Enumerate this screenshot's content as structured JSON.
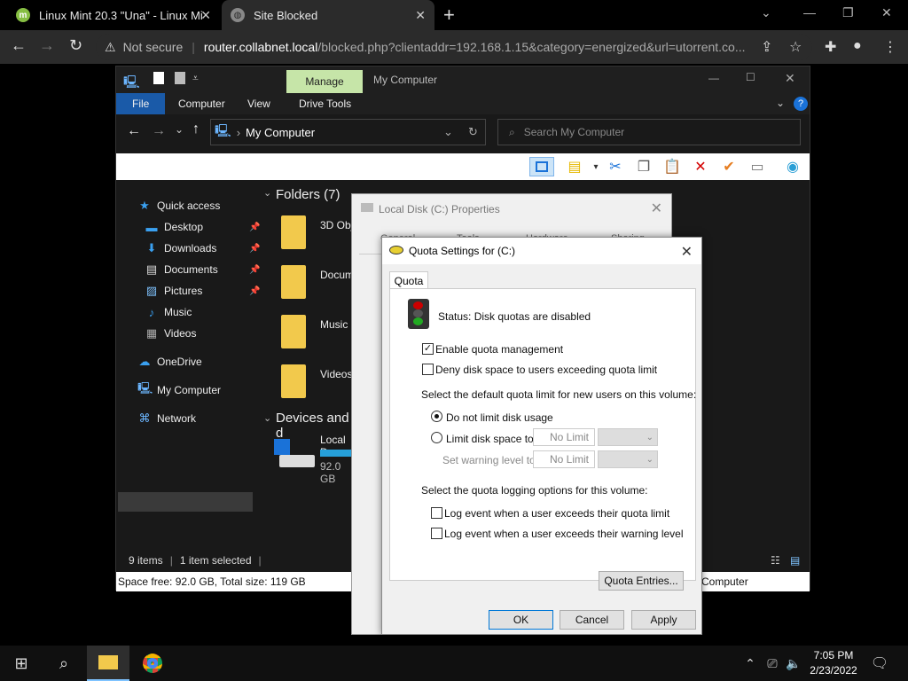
{
  "browser": {
    "tabs": [
      {
        "title": "Linux Mint 20.3 \"Una\" - Linux Mi",
        "favicon": "mint-logo-icon"
      },
      {
        "title": "Site Blocked",
        "favicon": "globe-icon"
      }
    ],
    "address": {
      "not_secure": "Not secure",
      "host": "router.collabnet.local",
      "path": "/blocked.php?clientaddr=192.168.1.15&category=energized&url=utorrent.co..."
    }
  },
  "explorer": {
    "ribbon_context": "Manage",
    "window_title": "My Computer",
    "ribbon_tabs": [
      "File",
      "Computer",
      "View",
      "Drive Tools"
    ],
    "address": "My Computer",
    "search_placeholder": "Search My Computer",
    "nav": {
      "quick_access": "Quick access",
      "items": [
        "Desktop",
        "Downloads",
        "Documents",
        "Pictures",
        "Music",
        "Videos"
      ],
      "onedrive": "OneDrive",
      "my_computer": "My Computer",
      "network": "Network"
    },
    "content": {
      "folders_header": "Folders (7)",
      "folders": [
        "3D Obj",
        "Docum",
        "Music",
        "Videos"
      ],
      "devices_header": "Devices and d",
      "drive_name": "Local D",
      "drive_free": "92.0 GB"
    },
    "status": {
      "items": "9 items",
      "selected": "1 item selected",
      "space": "Space free: 92.0 GB, Total size: 119 GB",
      "location": "Computer"
    }
  },
  "properties": {
    "title": "Local Disk (C:) Properties",
    "tabs": [
      "General",
      "Tools",
      "Hardware",
      "Sharing"
    ]
  },
  "quota": {
    "title": "Quota Settings for  (C:)",
    "tab": "Quota",
    "status": "Status:  Disk quotas are disabled",
    "enable_label": "Enable quota management",
    "enable_checked": true,
    "deny_label": "Deny disk space to users exceeding quota limit",
    "deny_checked": false,
    "default_limit_heading": "Select the default quota limit for new users on this volume:",
    "no_limit_label": "Do not limit disk usage",
    "limit_label": "Limit disk space to",
    "limit_value": "No Limit",
    "warning_label": "Set warning level to",
    "warning_value": "No Limit",
    "logging_heading": "Select the quota logging options for this volume:",
    "log_limit_label": "Log event when a user exceeds their quota limit",
    "log_warning_label": "Log event when a user exceeds their warning level",
    "entries_button": "Quota Entries...",
    "ok": "OK",
    "cancel": "Cancel",
    "apply": "Apply"
  },
  "taskbar": {
    "time": "7:05 PM",
    "date": "2/23/2022"
  },
  "colors": {
    "file_tab": "#1a5aa8",
    "manage_tab": "#c6e5a8",
    "folder": "#f2c94c"
  }
}
